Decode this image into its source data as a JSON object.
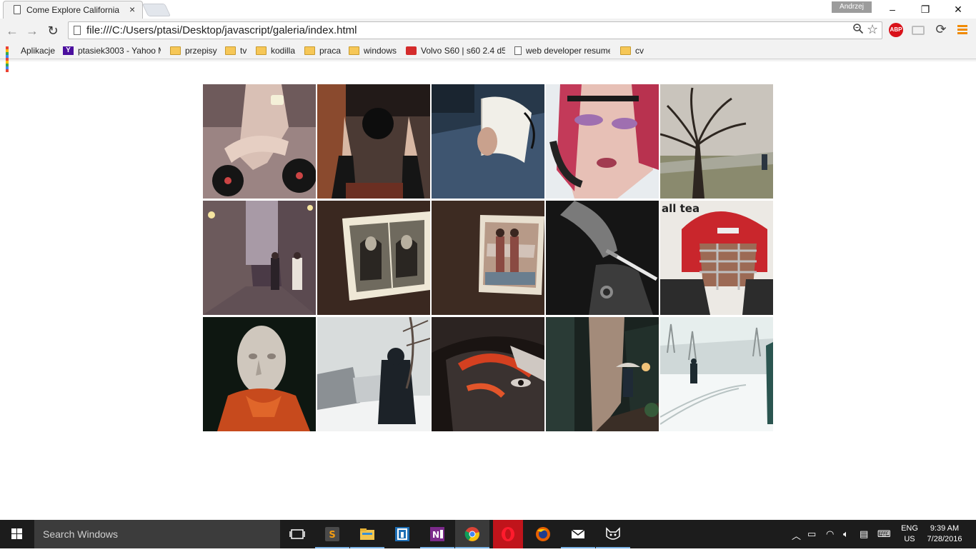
{
  "browser": {
    "tab_title": "Come Explore California",
    "tab_close": "×",
    "user_name": "Andrzej",
    "window_controls": [
      "–",
      "❐",
      "✕"
    ],
    "url": "file:///C:/Users/ptasi/Desktop/javascript/galeria/index.html",
    "extension_abp": "ABP",
    "nav": {
      "back": "←",
      "forward": "→",
      "reload": "↻"
    }
  },
  "bookmarks": [
    {
      "label": "Aplikacje",
      "icon": "apps-grid-icon"
    },
    {
      "label": "ptasiek3003 - Yahoo M",
      "icon": "yahoo-icon"
    },
    {
      "label": "przepisy",
      "icon": "folder-icon"
    },
    {
      "label": "tv",
      "icon": "folder-icon"
    },
    {
      "label": "kodilla",
      "icon": "folder-icon"
    },
    {
      "label": "praca",
      "icon": "folder-icon"
    },
    {
      "label": "windows",
      "icon": "folder-icon"
    },
    {
      "label": "Volvo S60 | s60 2.4 d5",
      "icon": "volvo-icon"
    },
    {
      "label": "web developer resume",
      "icon": "document-icon"
    },
    {
      "label": "cv",
      "icon": "folder-icon"
    }
  ],
  "gallery": {
    "photos": [
      {
        "subject": "legs-with-vinyl-records"
      },
      {
        "subject": "boots-with-vinyl-record"
      },
      {
        "subject": "hands-holding-book"
      },
      {
        "subject": "woman-with-headphones"
      },
      {
        "subject": "tree-in-field"
      },
      {
        "subject": "night-street-walkers"
      },
      {
        "subject": "old-photograph-men"
      },
      {
        "subject": "old-photograph-women"
      },
      {
        "subject": "hand-with-cigarette"
      },
      {
        "subject": "football-helmet-player"
      },
      {
        "subject": "glass-head-orange-scarf"
      },
      {
        "subject": "person-in-snow-with-car"
      },
      {
        "subject": "painted-face-mask"
      },
      {
        "subject": "person-with-umbrella-alley"
      },
      {
        "subject": "person-walking-snow"
      }
    ]
  },
  "taskbar": {
    "search_placeholder": "Search Windows",
    "apps": [
      "task-view-icon",
      "sublime-text-icon",
      "file-explorer-icon",
      "code-app-icon",
      "onenote-icon",
      "chrome-icon",
      "opera-icon",
      "firefox-icon",
      "mail-icon",
      "cat-app-icon"
    ],
    "language": "ENG",
    "region": "US",
    "time": "9:39 AM",
    "date": "7/28/2016"
  },
  "colors": {
    "chrome_bg": "#f2f2f2",
    "taskbar_bg": "#1c1c1c",
    "taskbar_search_bg": "#3c3c3c",
    "active_underline": "#7ab3e6",
    "menu_orange": "#f08a00"
  }
}
